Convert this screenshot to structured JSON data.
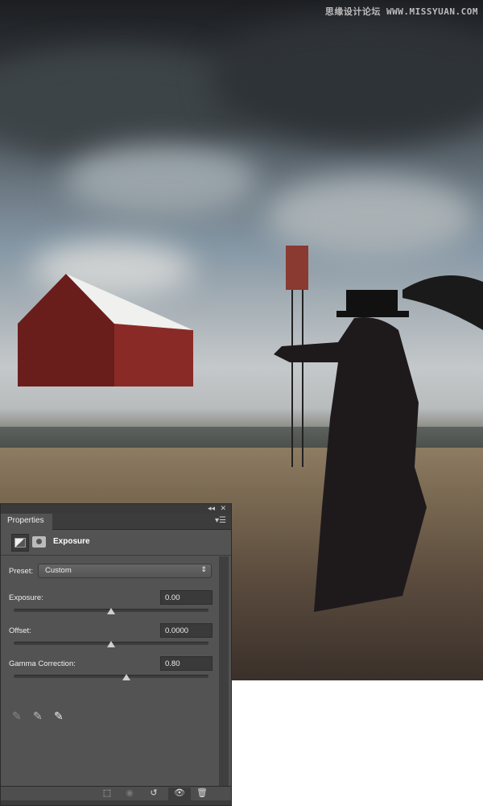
{
  "watermark": "思缘设计论坛 WWW.MISSYUAN.COM",
  "panel": {
    "tab_label": "Properties",
    "adjustment_title": "Exposure",
    "preset_label": "Preset:",
    "preset_value": "Custom",
    "fields": [
      {
        "label": "Exposure:",
        "value": "0.00",
        "slider_fraction": 0.5
      },
      {
        "label": "Offset:",
        "value": "0.0000",
        "slider_fraction": 0.5
      },
      {
        "label": "Gamma Correction:",
        "value": "0.80",
        "slider_fraction": 0.58
      }
    ],
    "eyedroppers": [
      "black-point-eyedropper",
      "gray-point-eyedropper",
      "white-point-eyedropper"
    ],
    "footer_buttons": [
      "clip-to-layer",
      "view-previous-state",
      "reset-adjustment",
      "toggle-visibility",
      "delete-adjustment"
    ]
  }
}
